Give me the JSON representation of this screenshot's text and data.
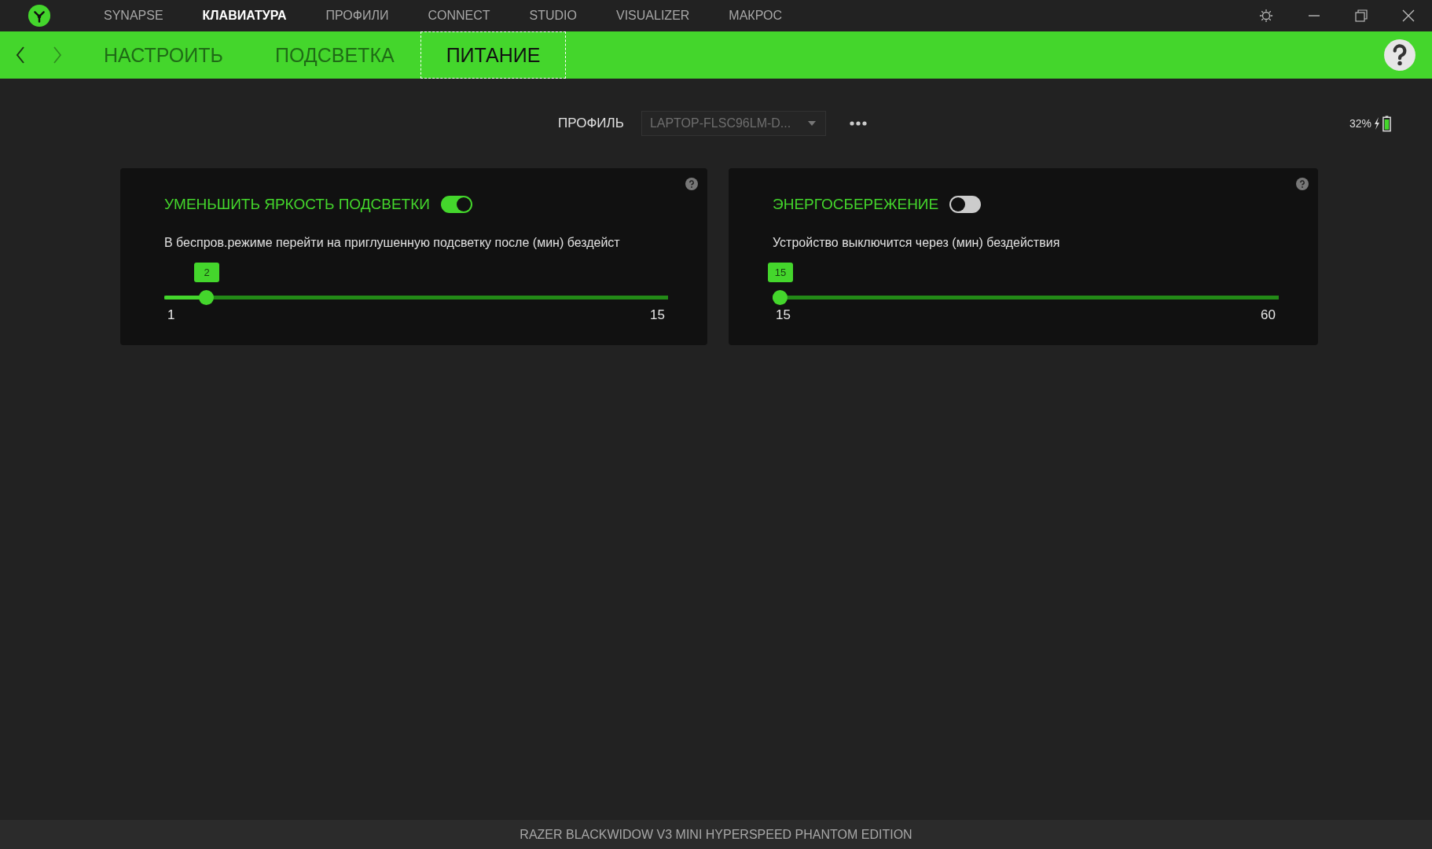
{
  "nav": [
    {
      "label": "SYNAPSE",
      "selected": false
    },
    {
      "label": "КЛАВИАТУРА",
      "selected": true
    },
    {
      "label": "ПРОФИЛИ",
      "selected": false
    },
    {
      "label": "CONNECT",
      "selected": false
    },
    {
      "label": "STUDIO",
      "selected": false
    },
    {
      "label": "VISUALIZER",
      "selected": false
    },
    {
      "label": "МАКРОС",
      "selected": false
    }
  ],
  "subtabs": [
    {
      "label": "НАСТРОИТЬ",
      "selected": false
    },
    {
      "label": "ПОДСВЕТКА",
      "selected": false
    },
    {
      "label": "ПИТАНИЕ",
      "selected": true
    }
  ],
  "profile": {
    "label": "ПРОФИЛЬ",
    "value": "LAPTOP-FLSC96LM-D..."
  },
  "battery": {
    "percent": "32%"
  },
  "cards": [
    {
      "title": "УМЕНЬШИТЬ ЯРКОСТЬ ПОДСВЕТКИ",
      "on": true,
      "description": "В беспров.режиме перейти на приглушенную подсветку после (мин) бездейст",
      "slider": {
        "value": "2",
        "level": 0.071,
        "min": "1",
        "max": "15"
      }
    },
    {
      "title": "ЭНЕРГОСБЕРЕЖЕНИЕ",
      "on": false,
      "description": "Устройство выключится через (мин) бездействия",
      "slider": {
        "value": "15",
        "level": 0,
        "min": "15",
        "max": "60"
      }
    }
  ],
  "status_bar": "RAZER BLACKWIDOW V3 MINI HYPERSPEED PHANTOM EDITION"
}
